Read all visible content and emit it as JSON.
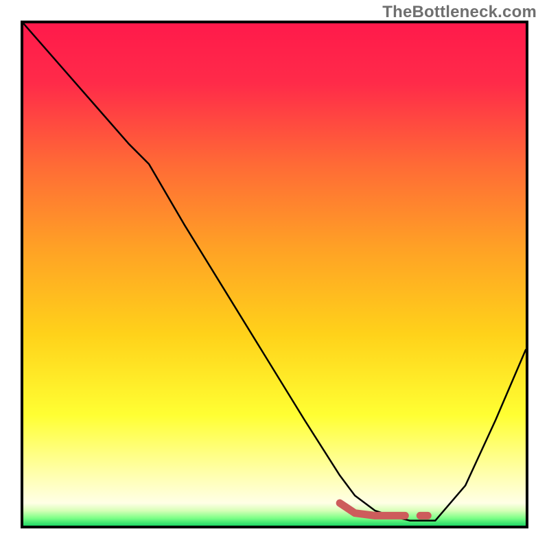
{
  "watermark": "TheBottleneck.com",
  "chart_data": {
    "type": "line",
    "title": "",
    "xlabel": "",
    "ylabel": "",
    "xlim": [
      0,
      100
    ],
    "ylim": [
      0,
      100
    ],
    "grid": false,
    "legend": false,
    "background_gradient": {
      "stops": [
        {
          "offset": 0.0,
          "color": "#ff1a4b"
        },
        {
          "offset": 0.12,
          "color": "#ff2b49"
        },
        {
          "offset": 0.28,
          "color": "#ff6a36"
        },
        {
          "offset": 0.45,
          "color": "#ffa225"
        },
        {
          "offset": 0.62,
          "color": "#ffd21a"
        },
        {
          "offset": 0.78,
          "color": "#ffff33"
        },
        {
          "offset": 0.9,
          "color": "#ffffb0"
        },
        {
          "offset": 0.955,
          "color": "#ffffe6"
        },
        {
          "offset": 0.97,
          "color": "#d7ffb8"
        },
        {
          "offset": 0.985,
          "color": "#7dff87"
        },
        {
          "offset": 1.0,
          "color": "#1fd765"
        }
      ]
    },
    "series": [
      {
        "name": "bottleneck-curve",
        "color": "#000000",
        "stroke_width": 2.5,
        "x": [
          0,
          7,
          14,
          21,
          25,
          32,
          40,
          48,
          56,
          63,
          66,
          70,
          73,
          77,
          82,
          88,
          94,
          100
        ],
        "y": [
          100,
          92,
          84,
          76,
          72,
          60,
          47,
          34,
          21,
          10,
          6,
          3,
          2,
          1,
          1,
          8,
          21,
          35
        ]
      },
      {
        "name": "highlight-segment",
        "color": "#cd5c5c",
        "stroke_width": 11,
        "x": [
          63,
          66,
          70,
          74,
          76
        ],
        "y": [
          4.5,
          2.5,
          2.0,
          2.0,
          2.0
        ]
      },
      {
        "name": "highlight-dot",
        "color": "#cd5c5c",
        "stroke_width": 11,
        "x": [
          79,
          80.5
        ],
        "y": [
          2.0,
          2.0
        ]
      }
    ]
  }
}
